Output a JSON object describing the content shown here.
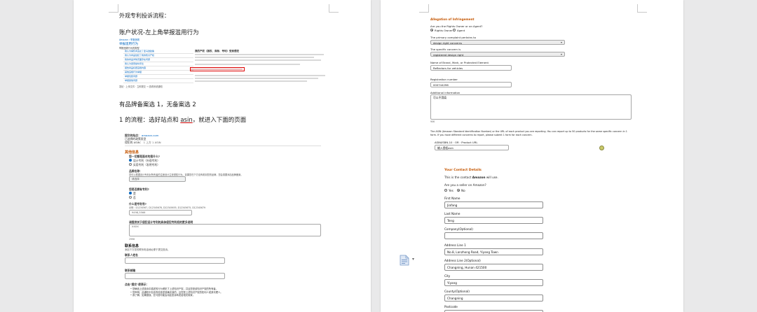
{
  "left_page": {
    "heading": "外观专利投诉流程：",
    "step1": "账户状况-左上角举报滥用行为",
    "shot1": {
      "breadcrumb": "Amazon › 举报违规",
      "title": "举报滥用行为",
      "subtitle": "举报违规行为的类型",
      "rows": [
        "我认为销售商违反了亚马逊政策",
        "我认为商品侵犯了我的知识产权",
        "我的商品详情页面存在问题",
        "我认为卖家操纵评论",
        "报告商品标题违规内容",
        "其他违规行为举报",
        "举报包装问题",
        "举报其他问题"
      ],
      "right_title": "我的产权（版权、商标、专利）受到侵犯",
      "footer": "发帖 · 上传文件 · 立即提交 → 查看系统通知"
    },
    "step2": "有品牌备案选 1，无备案选 2",
    "step3_pre": "1 的流程：选好站点和 ",
    "step3_asin": "asin",
    "step3_post": "，就进入下面的页面",
    "shot2": {
      "site_label": "提交的站点：",
      "site_value": "amazon.com",
      "selected_label": "已选择的政策类型",
      "policy_label": "侵犯的 ASIN：",
      "policy_value": "1 上方 1 ASIN",
      "other_title": "其他信息",
      "q1": "您一切都是面对的是什么?",
      "opt1": "设计专利（外观专利）",
      "opt2": "实用专利（发明专利）",
      "brand_label": "品牌名称：",
      "brand_hint": "您可以根据设计专利对所有者的注册设计主张侵权行为。如果您在下方没有看到您的品牌，您会需要添加品牌备案。",
      "brand_select": "请选择",
      "q2": "您是否拥有专利?",
      "yes": "是",
      "no": "否",
      "patent_label": "什么是专利号?",
      "patent_hint": "示例：D1234567, D12345678, D12345655, D12345675, D12345679",
      "patent_value": "9498,3566",
      "detail_label": "请提供关于侵犯设计专利的具体侵犯专利权的更多说明",
      "detail_value": "XXXX",
      "count": "2996",
      "contact_title": "联系信息",
      "contact_hint": "添加下方您的联系电话地址便于提交投诉。",
      "name_label": "联系人姓名",
      "email_label": "联系邮箱",
      "notes_title": "点击\"提交\"便表示：",
      "bullets": [
        "您确信上述投诉中描述的行为侵犯了上述知识产权，并且您是该知识产权的所有者。",
        "您声明，此通知中包含的信息是准确无误的，且您是上述知识产权的权利人或其代理人。",
        "我了解，如果错误，亚马逊可能会将此投诉转发给相关卖家。"
      ]
    }
  },
  "right_page": {
    "allegation_title": "Allegation of Infringement",
    "q_role": "Are you the Rights Owner or an Agent?",
    "role_owner": "Rights Owner",
    "role_agent": "Agent",
    "q_complaint": "The primary complaint pertains to",
    "complaint_value": "design right concerns",
    "q_concern": "The specific concern is",
    "concern_value": "registered design right",
    "q_name": "Name of Brand, Mark, or Protected Element",
    "name_value": "Reflectors for vehicles",
    "q_reg": "Registration number",
    "reg_value": "000744296",
    "q_additional": "Additional information",
    "additional_value": "可以不用填",
    "count": "906",
    "asin_desc": "The ASIN (Amazon Standard Identification Number) or the URL of each product you are reporting. You can report up to 50 products for the same specific concern in 1 form. If you have different concerns to report, please submit 1 form for each concern.",
    "asin_label": "ASIN/ISBN-10 · OR · Product URL",
    "asin_value": "输入侵权asin",
    "contact_title": "Your Contact Details",
    "contact_note_pre": "This is the contact ",
    "contact_note_brand": "Amazon",
    "contact_note_post": " will use.",
    "q_seller": "Are you a seller on Amazon?",
    "seller_yes": "Yes",
    "seller_no": "No",
    "fields": [
      {
        "label": "First Name",
        "value": "Jiafang"
      },
      {
        "label": "Last Name",
        "value": "Teng"
      },
      {
        "label": "Company(Optional)",
        "value": ""
      },
      {
        "label": "Address Line 1",
        "value": "No.8, Lanzhong Road, Yiyang Town"
      },
      {
        "label": "Address Line 2(Optional)",
        "value": "Changning, Hunan 421500"
      },
      {
        "label": "City",
        "value": "Yiyang"
      },
      {
        "label": "County(Optional)",
        "value": "Changning"
      },
      {
        "label": "Postcode",
        "value": ""
      }
    ]
  },
  "colors": {
    "accent_orange": "#c45500",
    "link_blue": "#0066c0",
    "red_highlight": "#cc0000"
  }
}
